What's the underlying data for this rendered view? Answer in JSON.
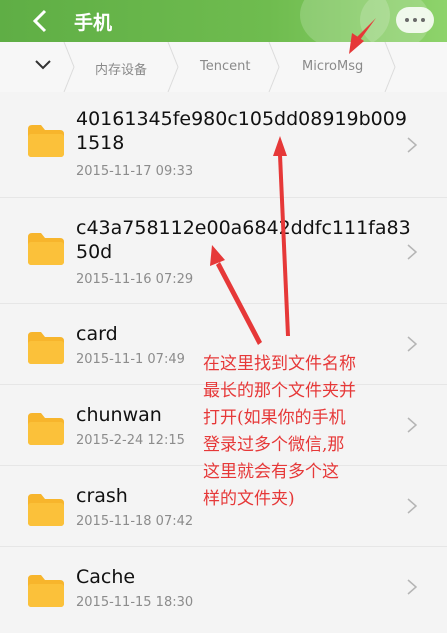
{
  "header": {
    "title": "手机",
    "back_icon": "chevron-left-icon",
    "more_icon": "more-dots-icon",
    "colors": {
      "bar": "#6fbc4f",
      "accent_text": "#e63838"
    }
  },
  "breadcrumb": {
    "items": [
      "内存设备",
      "Tencent",
      "MicroMsg"
    ],
    "toggle_icon": "chevron-down-icon"
  },
  "files": [
    {
      "name": "40161345fe980c105dd08919b0091518",
      "date": "2015-11-17 09:33",
      "icon": "folder-icon"
    },
    {
      "name": "c43a758112e00a6842ddfc111fa8350d",
      "date": "2015-11-16 07:29",
      "icon": "folder-icon"
    },
    {
      "name": "card",
      "date": "2015-11-1 07:49",
      "icon": "folder-icon"
    },
    {
      "name": "chunwan",
      "date": "2015-2-24 12:15",
      "icon": "folder-icon"
    },
    {
      "name": "crash",
      "date": "2015-11-18 07:42",
      "icon": "folder-icon"
    },
    {
      "name": "Cache",
      "date": "2015-11-15 18:30",
      "icon": "folder-icon"
    }
  ],
  "annotation": {
    "lines": [
      "在这里找到文件名称",
      "最长的那个文件夹并",
      "打开(如果你的手机",
      "登录过多个微信,那",
      "这里就会有多个这",
      "样的文件夹)"
    ]
  }
}
